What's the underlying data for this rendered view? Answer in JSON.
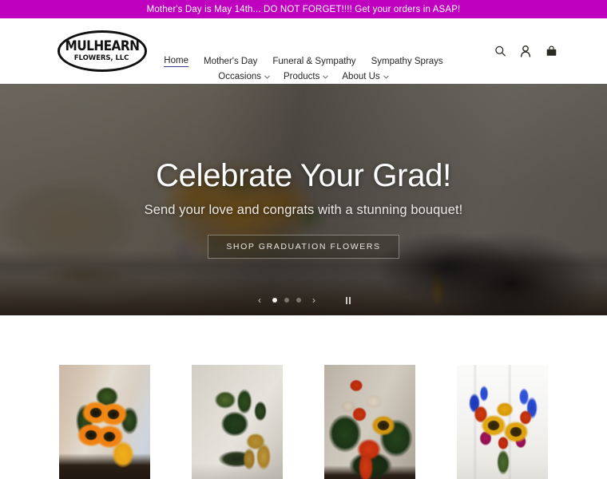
{
  "announcement": {
    "text": "Mother's Day is May 14th... DO NOT FORGET!!!! Get your orders in ASAP!",
    "background_color": "#bf00bf",
    "text_color": "#ffffff"
  },
  "header": {
    "logo": {
      "line1": "MULHEARN",
      "line2": "FLOWERS, LLC",
      "shape": "oval-outline"
    },
    "nav_row1": [
      {
        "label": "Home",
        "active": true,
        "has_dropdown": false
      },
      {
        "label": "Mother's Day",
        "active": false,
        "has_dropdown": false
      },
      {
        "label": "Funeral & Sympathy",
        "active": false,
        "has_dropdown": false
      },
      {
        "label": "Sympathy Sprays",
        "active": false,
        "has_dropdown": false
      }
    ],
    "nav_row2": [
      {
        "label": "Occasions",
        "active": false,
        "has_dropdown": true,
        "caret": "⌄"
      },
      {
        "label": "Products",
        "active": false,
        "has_dropdown": true,
        "caret": "⌄"
      },
      {
        "label": "About Us",
        "active": false,
        "has_dropdown": true,
        "caret": "⌄"
      }
    ],
    "icons": [
      {
        "name": "search-icon",
        "title": "Search"
      },
      {
        "name": "account-icon",
        "title": "Log in"
      },
      {
        "name": "cart-icon",
        "title": "Cart"
      }
    ]
  },
  "hero": {
    "title": "Celebrate Your Grad!",
    "subtitle": "Send your love and congrats with a stunning bouquet!",
    "cta_label": "SHOP GRADUATION FLOWERS",
    "image_description": "Sunflower bouquet in a glass vase on a living room table with a black graduation cap and gold tassel",
    "slider": {
      "total_slides": 3,
      "active_slide": 1,
      "prev_label": "‹",
      "next_label": "›",
      "playing": true,
      "pause_label": "Pause slideshow"
    }
  },
  "products": [
    {
      "name": "product-1",
      "alt": "Orange sunflower arrangement with yellow bow"
    },
    {
      "name": "product-2",
      "alt": "Green dieffenbachia planter with burlap bow"
    },
    {
      "name": "product-3",
      "alt": "Red rose and sunflower arrangement with orange bow"
    },
    {
      "name": "product-4",
      "alt": "Mixed sunflower, delphinium and rose bouquet in glass vase"
    }
  ]
}
